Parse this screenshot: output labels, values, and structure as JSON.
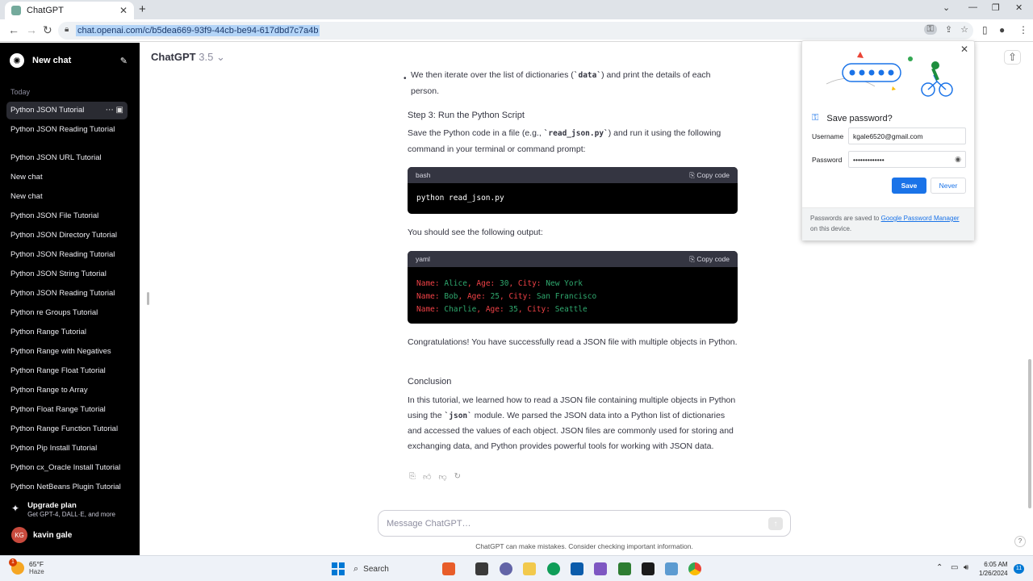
{
  "browser": {
    "tab_title": "ChatGPT",
    "url": "chat.openai.com/c/b5dea669-93f9-44cb-be94-617dbd7c7a4b"
  },
  "sidebar": {
    "new_chat": "New chat",
    "section": "Today",
    "items": [
      "Python JSON Tutorial",
      "Python JSON Reading Tutorial",
      "Python JSON URL Tutorial",
      "New chat",
      "New chat",
      "Python JSON File Tutorial",
      "Python JSON Directory Tutorial",
      "Python JSON Reading Tutorial",
      "Python JSON String Tutorial",
      "Python JSON Reading Tutorial",
      "Python re Groups Tutorial",
      "Python Range Tutorial",
      "Python Range with Negatives",
      "Python Range Float Tutorial",
      "Python Range to Array",
      "Python Float Range Tutorial",
      "Python Range Function Tutorial",
      "Python Pip Install Tutorial",
      "Python cx_Oracle Install Tutorial",
      "Python NetBeans Plugin Tutorial"
    ],
    "upgrade_title": "Upgrade plan",
    "upgrade_sub": "Get GPT-4, DALL·E, and more",
    "user_initials": "KG",
    "user_name": "kavin gale"
  },
  "header": {
    "model": "ChatGPT",
    "version": "3.5"
  },
  "content": {
    "bullet_pre": "We then iterate over the list of dictionaries (",
    "bullet_code": "`data`",
    "bullet_post": ") and print the details of each person.",
    "step3": "Step 3: Run the Python Script",
    "save_pre": "Save the Python code in a file (e.g., ",
    "save_code": "`read_json.py`",
    "save_post": ") and run it using the following command in your terminal or command prompt:",
    "code1_lang": "bash",
    "copy_label": "Copy code",
    "code1": "python read_json.py",
    "output_intro": "You should see the following output:",
    "code2_lang": "yaml",
    "output_lines": [
      {
        "k1": "Name:",
        "v1": "Alice",
        "k2": ", Age:",
        "v2": "30",
        "k3": ", City:",
        "v3": "New York"
      },
      {
        "k1": "Name:",
        "v1": "Bob",
        "k2": ", Age:",
        "v2": "25",
        "k3": ", City:",
        "v3": "San Francisco"
      },
      {
        "k1": "Name:",
        "v1": "Charlie",
        "k2": ", Age:",
        "v2": "35",
        "k3": ", City:",
        "v3": "Seattle"
      }
    ],
    "congrats": "Congratulations! You have successfully read a JSON file with multiple objects in Python.",
    "conclusion_title": "Conclusion",
    "concl_pre": "In this tutorial, we learned how to read a JSON file containing multiple objects in Python using the ",
    "concl_code": "`json`",
    "concl_post": " module. We parsed the JSON data into a Python list of dictionaries and accessed the values of each object. JSON files are commonly used for storing and exchanging data, and Python provides powerful tools for working with JSON data."
  },
  "composer": {
    "placeholder": "Message ChatGPT…",
    "disclaimer": "ChatGPT can make mistakes. Consider checking important information."
  },
  "password_popup": {
    "title": "Save password?",
    "username_label": "Username",
    "username": "kgale6520@gmail.com",
    "password_label": "Password",
    "password_mask": "•••••••••••••",
    "save": "Save",
    "never": "Never",
    "footer_pre": "Passwords are saved to ",
    "footer_link": "Google Password Manager",
    "footer_post": " on this device."
  },
  "taskbar": {
    "temp": "65°F",
    "condition": "Haze",
    "weather_badge": "1",
    "search": "Search",
    "time": "6:05 AM",
    "date": "1/26/2024",
    "notifications": "11"
  },
  "colors": {
    "accent": "#1a73e8",
    "sidebar_bg": "#000000",
    "yaml_key": "#ef4146",
    "yaml_value": "#2fa86e"
  }
}
